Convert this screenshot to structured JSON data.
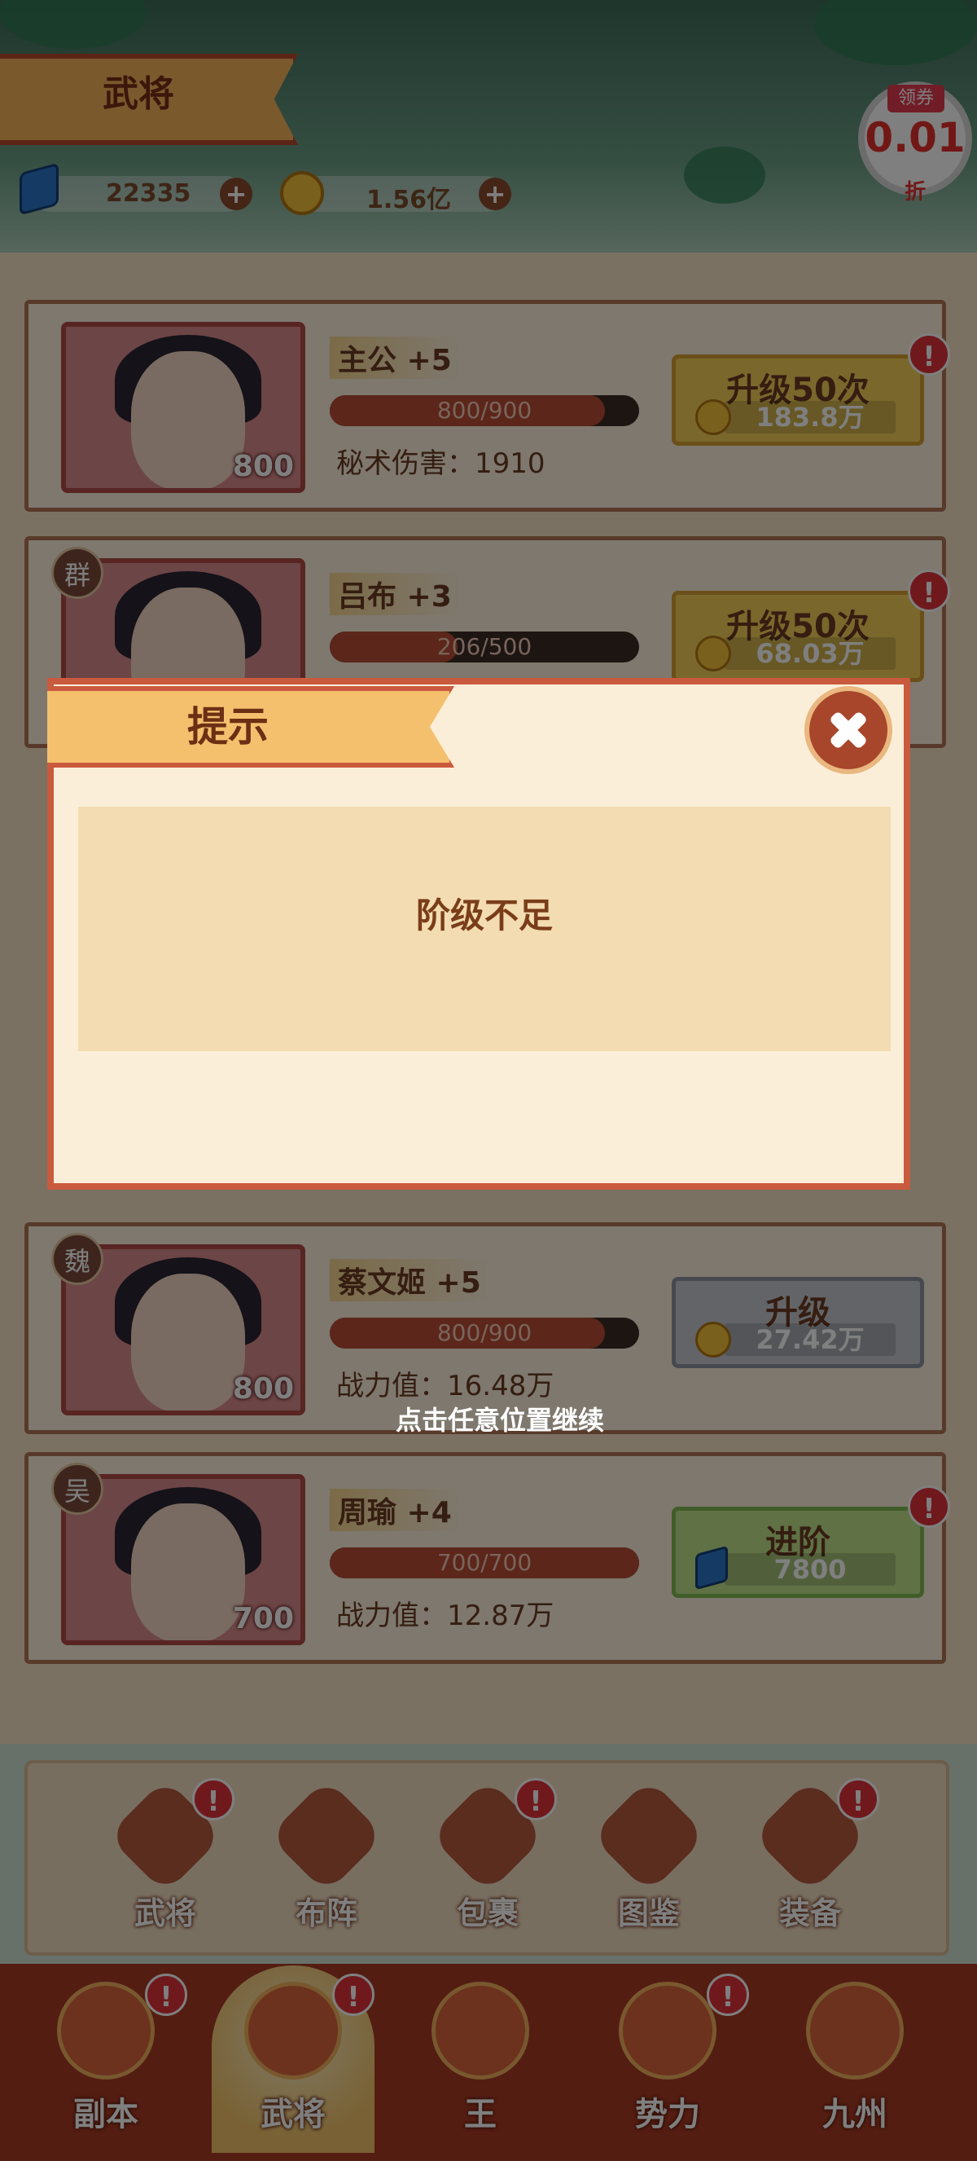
{
  "header": {
    "title": "武将",
    "gems": "22335",
    "coins": "1.56亿",
    "promo": {
      "tag": "领券",
      "value": "0.01",
      "unit": "折"
    }
  },
  "cards": [
    {
      "name": "主公 +5",
      "progress": "800/900",
      "progress_ratio": 0.889,
      "stat": "秘术伤害：1910",
      "level": "800",
      "faction": "",
      "button": {
        "label": "升级50次",
        "cost": "183.8万",
        "style": "gold",
        "currency": "coin"
      },
      "alert": true
    },
    {
      "name": "吕布 +3",
      "progress": "206/500",
      "progress_ratio": 0.412,
      "stat": "",
      "level": "",
      "faction": "群",
      "button": {
        "label": "升级50次",
        "cost": "68.03万",
        "style": "gold",
        "currency": "coin"
      },
      "alert": true
    },
    {
      "name": "蔡文姬 +5",
      "progress": "800/900",
      "progress_ratio": 0.889,
      "stat": "战力值：16.48万",
      "level": "800",
      "faction": "魏",
      "button": {
        "label": "升级",
        "cost": "27.42万",
        "style": "gray",
        "currency": "coin"
      },
      "alert": false
    },
    {
      "name": "周瑜 +4",
      "progress": "700/700",
      "progress_ratio": 1.0,
      "stat": "战力值：12.87万",
      "level": "700",
      "faction": "吴",
      "button": {
        "label": "进阶",
        "cost": "7800",
        "style": "green",
        "currency": "gem"
      },
      "alert": true
    }
  ],
  "dialog": {
    "title": "提示",
    "message": "阶级不足",
    "hint": "点击任意位置继续"
  },
  "subnav": [
    {
      "label": "武将",
      "icon": "helmet-icon",
      "alert": true
    },
    {
      "label": "布阵",
      "icon": "formation-icon",
      "alert": false
    },
    {
      "label": "包裹",
      "icon": "bag-icon",
      "alert": true
    },
    {
      "label": "图鉴",
      "icon": "book-icon",
      "alert": false
    },
    {
      "label": "装备",
      "icon": "armor-icon",
      "alert": true
    }
  ],
  "bottomnav": [
    {
      "label": "副本",
      "icon": "jar-icon",
      "alert": true
    },
    {
      "label": "武将",
      "icon": "general-icon",
      "alert": true,
      "active": true
    },
    {
      "label": "王",
      "icon": "sword-icon",
      "alert": false
    },
    {
      "label": "势力",
      "icon": "faction-icon",
      "alert": true
    },
    {
      "label": "九州",
      "icon": "flag-icon",
      "alert": false
    }
  ]
}
